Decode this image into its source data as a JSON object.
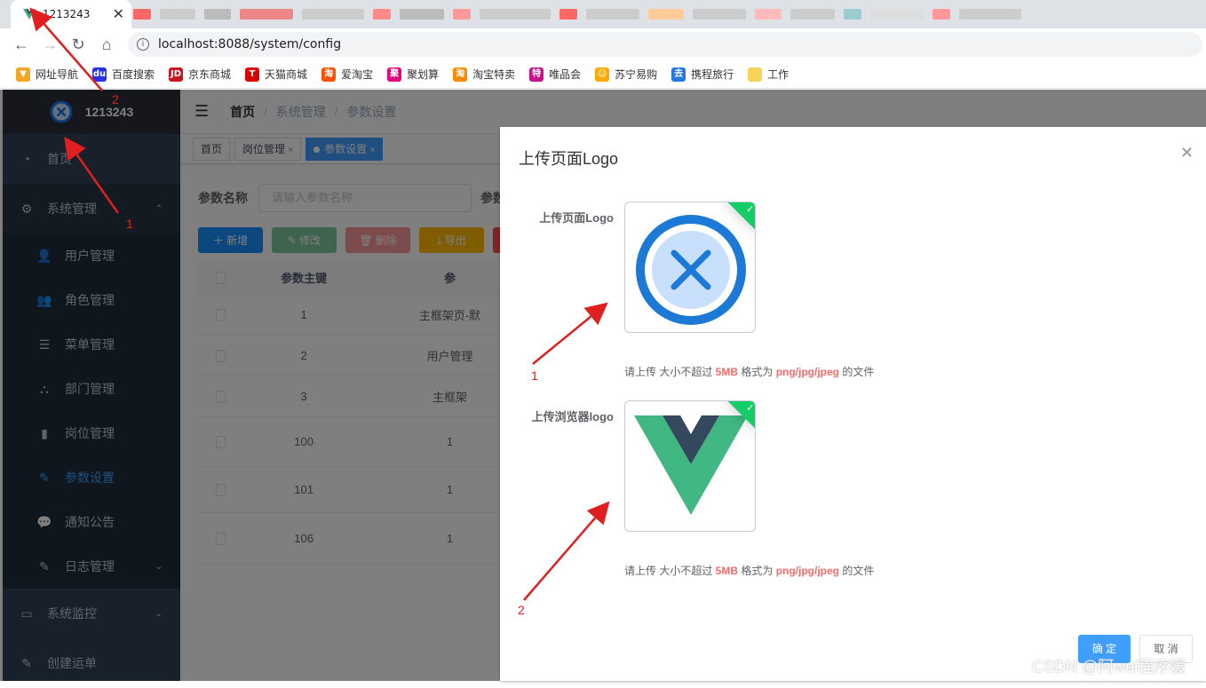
{
  "browser": {
    "tab_title": "1213243",
    "tab_close": "✕",
    "url": "localhost:8088/system/config",
    "bookmarks": [
      {
        "label": "网址导航",
        "color": "#f5a623",
        "glyph": "▼"
      },
      {
        "label": "百度搜索",
        "color": "#2932e1",
        "glyph": "du"
      },
      {
        "label": "京东商城",
        "color": "#c81623",
        "glyph": "JD"
      },
      {
        "label": "天猫商城",
        "color": "#d00",
        "glyph": "T"
      },
      {
        "label": "爱淘宝",
        "color": "#ff5000",
        "glyph": "淘"
      },
      {
        "label": "聚划算",
        "color": "#e4007f",
        "glyph": "聚"
      },
      {
        "label": "淘宝特卖",
        "color": "#ff8a00",
        "glyph": "淘"
      },
      {
        "label": "唯品会",
        "color": "#c4138d",
        "glyph": "特"
      },
      {
        "label": "苏宁易购",
        "color": "#ffaa00",
        "glyph": "☺"
      },
      {
        "label": "携程旅行",
        "color": "#2577e3",
        "glyph": "去"
      },
      {
        "label": "工作",
        "color": "#f7d358",
        "glyph": ""
      }
    ]
  },
  "sidebar": {
    "logo_title": "1213243",
    "items": [
      {
        "label": "首页",
        "icon": "dashboard-icon"
      },
      {
        "label": "系统管理",
        "icon": "gear-icon",
        "chevron": "⌃"
      }
    ],
    "sub_items": [
      {
        "label": "用户管理",
        "icon": "user-icon",
        "glyph": "👤"
      },
      {
        "label": "角色管理",
        "icon": "peoples-icon",
        "glyph": "👥"
      },
      {
        "label": "菜单管理",
        "icon": "tree-table-icon",
        "glyph": "☰"
      },
      {
        "label": "部门管理",
        "icon": "tree-icon",
        "glyph": "⛬"
      },
      {
        "label": "岗位管理",
        "icon": "post-icon",
        "glyph": "▮"
      },
      {
        "label": "参数设置",
        "icon": "edit-icon",
        "glyph": "✎",
        "active": true
      },
      {
        "label": "通知公告",
        "icon": "message-icon",
        "glyph": "💬"
      },
      {
        "label": "日志管理",
        "icon": "log-icon",
        "glyph": "✎",
        "chevron": "⌄"
      }
    ],
    "bottom_items": [
      {
        "label": "系统监控",
        "icon": "monitor-icon",
        "chevron": "⌄"
      },
      {
        "label": "创建运单",
        "icon": "form-icon"
      }
    ]
  },
  "navbar": {
    "breadcrumbs": [
      "首页",
      "系统管理",
      "参数设置"
    ],
    "separator": "/"
  },
  "tags": [
    {
      "label": "首页",
      "close": ""
    },
    {
      "label": "岗位管理",
      "close": "×"
    },
    {
      "label": "参数设置",
      "close": "×",
      "active": true
    }
  ],
  "search": {
    "label": "参数名称",
    "placeholder": "请输入参数名称",
    "label2": "参数"
  },
  "toolbar": [
    {
      "label": "＋ 新增",
      "color": "#1890ff"
    },
    {
      "label": "✎ 修改",
      "color": "#7dc79e"
    },
    {
      "label": "🗑 删除",
      "color": "#f89898"
    },
    {
      "label": "⤓ 导出",
      "color": "#ffba00"
    }
  ],
  "table": {
    "headers": [
      "参数主键",
      "参"
    ],
    "rows": [
      {
        "id": "1",
        "name": "主框架页-默"
      },
      {
        "id": "2",
        "name": "用户管理"
      },
      {
        "id": "3",
        "name": "主框架"
      },
      {
        "id": "100",
        "name": "1"
      },
      {
        "id": "101",
        "name": "1"
      },
      {
        "id": "106",
        "name": "1"
      }
    ]
  },
  "dialog": {
    "title": "上传页面Logo",
    "close": "✕",
    "field1_label": "上传页面Logo",
    "field2_label": "上传浏览器logo",
    "tip_prefix": "请上传 大小不超过 ",
    "tip_size": "5MB",
    "tip_mid": " 格式为 ",
    "tip_format": "png/jpg/jpeg",
    "tip_suffix": " 的文件",
    "ok_label": "确 定",
    "cancel_label": "取 消",
    "check": "✓"
  },
  "annotations": {
    "a1": "1",
    "a2": "2",
    "d1": "1",
    "d2": "2"
  },
  "watermark": "CSDN @阿wei程序媛"
}
